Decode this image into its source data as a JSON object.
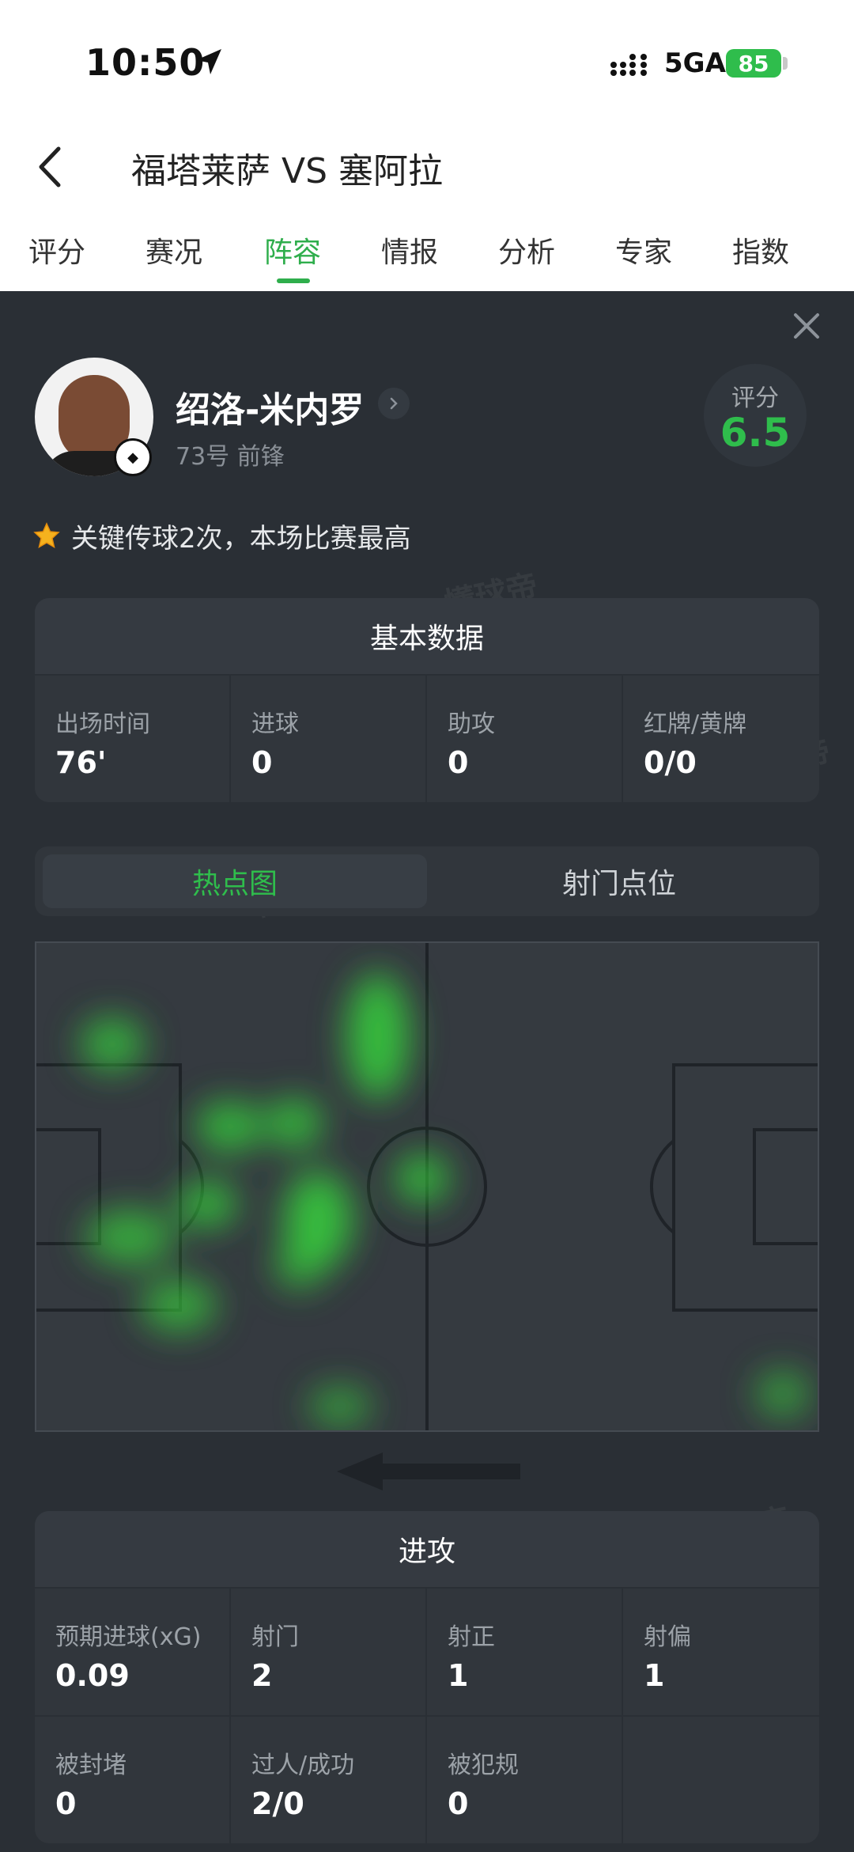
{
  "status_bar": {
    "time": "10:50",
    "network": "5GA",
    "battery": "85"
  },
  "header": {
    "title": "福塔莱萨 VS 塞阿拉",
    "back_icon": "chevron-left-icon"
  },
  "tabs": [
    {
      "label": "评分",
      "active": false
    },
    {
      "label": "赛况",
      "active": false
    },
    {
      "label": "阵容",
      "active": true
    },
    {
      "label": "情报",
      "active": false
    },
    {
      "label": "分析",
      "active": false
    },
    {
      "label": "专家",
      "active": false
    },
    {
      "label": "指数",
      "active": false
    }
  ],
  "player": {
    "name": "绍洛-米内罗",
    "number_position": "73号 前锋",
    "rating_label": "评分",
    "rating": "6.5",
    "highlight": "关键传球2次，本场比赛最高",
    "highlight_icon": "star-icon"
  },
  "basic_stats": {
    "title": "基本数据",
    "items": [
      {
        "label": "出场时间",
        "value": "76'"
      },
      {
        "label": "进球",
        "value": "0"
      },
      {
        "label": "助攻",
        "value": "0"
      },
      {
        "label": "红牌/黄牌",
        "value": "0/0"
      }
    ]
  },
  "map_tabs": {
    "heatmap": "热点图",
    "shot_map": "射门点位",
    "active": "heatmap"
  },
  "watermark": "懂球帝",
  "attack_stats": {
    "title": "进攻",
    "items": [
      {
        "label": "预期进球(xG)",
        "value": "0.09"
      },
      {
        "label": "射门",
        "value": "2"
      },
      {
        "label": "射正",
        "value": "1"
      },
      {
        "label": "射偏",
        "value": "1"
      },
      {
        "label": "被封堵",
        "value": "0"
      },
      {
        "label": "过人/成功",
        "value": "2/0"
      },
      {
        "label": "被犯规",
        "value": "0"
      },
      {
        "label": "",
        "value": ""
      }
    ]
  },
  "colors": {
    "accent": "#2fbd4c",
    "panel_bg": "#2a2f35",
    "card_bg": "#31363c"
  }
}
